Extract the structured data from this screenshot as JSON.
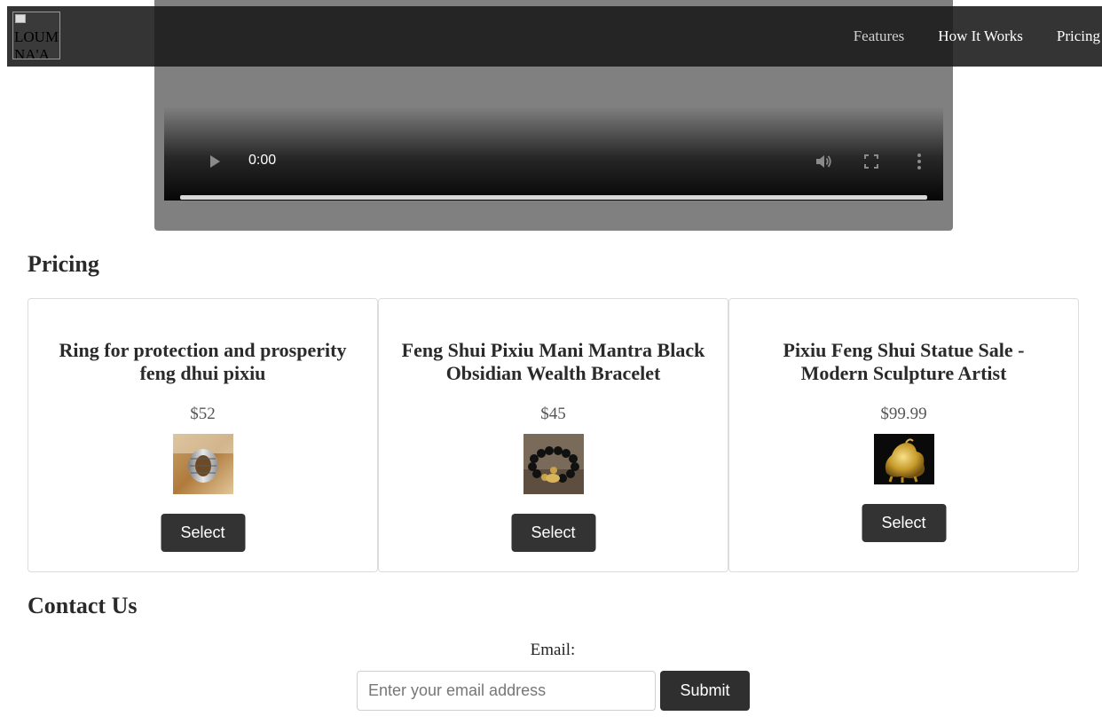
{
  "nav": {
    "logo_alt": "LOUMNA'A",
    "links": [
      {
        "label": "Features"
      },
      {
        "label": "How It Works"
      },
      {
        "label": "Pricing"
      }
    ]
  },
  "video": {
    "current_time": "0:00",
    "icons": [
      "play-icon",
      "volume-icon",
      "fullscreen-icon",
      "more-options-icon"
    ]
  },
  "pricing": {
    "title": "Pricing",
    "products": [
      {
        "name": "Ring for protection and prosperity feng dhui pixiu",
        "price": "$52",
        "image": "silver-spinner-ring",
        "button_label": "Select"
      },
      {
        "name": "Feng Shui Pixiu Mani Mantra Black Obsidian Wealth Bracelet",
        "price": "$45",
        "image": "obsidian-bead-bracelet",
        "button_label": "Select"
      },
      {
        "name": "Pixiu Feng Shui Statue Sale - Modern Sculpture Artist",
        "price": "$99.99",
        "image": "golden-pixiu-statue",
        "button_label": "Select"
      }
    ]
  },
  "contact": {
    "title": "Contact Us",
    "email_label": "Email:",
    "email_placeholder": "Enter your email address",
    "email_value": "",
    "submit_label": "Submit"
  },
  "colors": {
    "navbar_bg": "#181818",
    "button_bg": "#333333",
    "video_bg": "#808080"
  }
}
